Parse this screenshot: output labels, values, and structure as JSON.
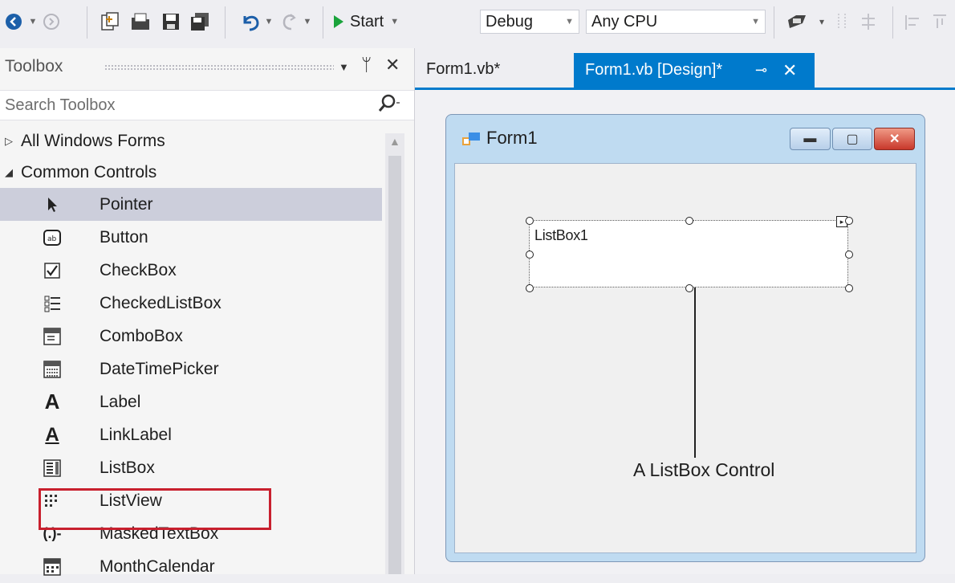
{
  "toolbar": {
    "start_label": "Start",
    "config_value": "Debug",
    "platform_value": "Any CPU"
  },
  "toolbox": {
    "title": "Toolbox",
    "search_placeholder": "Search Toolbox",
    "categories": [
      {
        "label": "All Windows Forms",
        "expanded": false
      },
      {
        "label": "Common Controls",
        "expanded": true
      }
    ],
    "items": [
      {
        "label": "Pointer",
        "icon": "pointer-icon",
        "selected": true
      },
      {
        "label": "Button",
        "icon": "button-icon"
      },
      {
        "label": "CheckBox",
        "icon": "checkbox-icon"
      },
      {
        "label": "CheckedListBox",
        "icon": "checkedlistbox-icon"
      },
      {
        "label": "ComboBox",
        "icon": "combobox-icon"
      },
      {
        "label": "DateTimePicker",
        "icon": "datetimepicker-icon"
      },
      {
        "label": "Label",
        "icon": "label-icon"
      },
      {
        "label": "LinkLabel",
        "icon": "linklabel-icon"
      },
      {
        "label": "ListBox",
        "icon": "listbox-icon",
        "highlighted": true
      },
      {
        "label": "ListView",
        "icon": "listview-icon"
      },
      {
        "label": "MaskedTextBox",
        "icon": "maskedtextbox-icon"
      },
      {
        "label": "MonthCalendar",
        "icon": "monthcalendar-icon"
      }
    ]
  },
  "tabs": [
    {
      "label": "Form1.vb*",
      "active": false
    },
    {
      "label": "Form1.vb [Design]*",
      "active": true
    }
  ],
  "designer": {
    "form_title": "Form1",
    "listbox_label": "ListBox1",
    "callout": "A ListBox Control"
  },
  "colors": {
    "accent": "#007acc",
    "highlight": "#c8202e",
    "selection": "#cccedb"
  }
}
